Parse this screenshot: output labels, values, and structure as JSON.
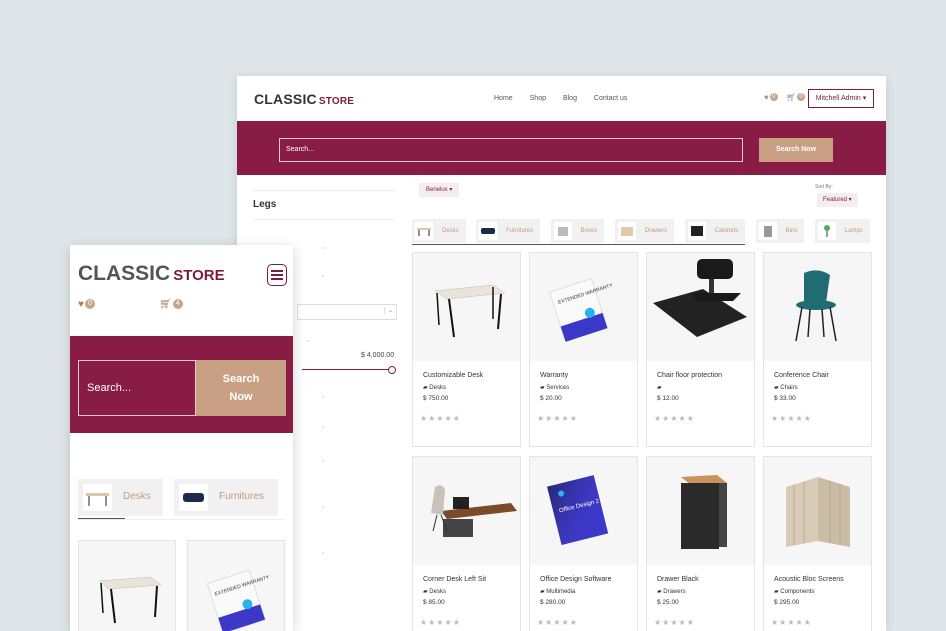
{
  "desktop": {
    "logo": {
      "main": "CLASSIC",
      "accent": "STORE"
    },
    "nav": [
      "Home",
      "Shop",
      "Blog",
      "Contact us"
    ],
    "wishlist_count": "0",
    "cart_count": "0",
    "user_label": "Mitchell Admin",
    "search": {
      "placeholder": "Search...",
      "button": "Search Now"
    },
    "sidebar": {
      "heading": "Legs",
      "range_max": "$ 4,000.00"
    },
    "region": "Benelux",
    "sort_label": "Sort By:",
    "sort_value": "Featured",
    "categories": [
      "Desks",
      "Furnitures",
      "Boxes",
      "Drawers",
      "Cabinets",
      "Bins",
      "Lamps"
    ],
    "products": [
      {
        "name": "Customizable Desk",
        "category": "Desks",
        "price": "$ 750.00"
      },
      {
        "name": "Warranty",
        "category": "Services",
        "price": "$ 20.00"
      },
      {
        "name": "Chair floor protection",
        "category": "",
        "price": "$ 12.00"
      },
      {
        "name": "Conference Chair",
        "category": "Chairs",
        "price": "$ 33.00"
      },
      {
        "name": "Corner Desk Left Sit",
        "category": "Desks",
        "price": "$ 85.00"
      },
      {
        "name": "Office Design Software",
        "category": "Multimedia",
        "price": "$ 280.00"
      },
      {
        "name": "Drawer Black",
        "category": "Drawers",
        "price": "$ 25.00"
      },
      {
        "name": "Acoustic Bloc Screens",
        "category": "Components",
        "price": "$ 295.00"
      }
    ],
    "rating_stars": "★★★★★",
    "box_text": {
      "warranty": "EXTENDED WARRANTY",
      "software": "Office Design 2"
    }
  },
  "mobile": {
    "logo": {
      "main": "CLASSIC",
      "accent": "STORE"
    },
    "wishlist_count": "0",
    "cart_count": "4",
    "search": {
      "placeholder": "Search...",
      "button": "Search Now"
    },
    "categories": [
      "Desks",
      "Furnitures"
    ]
  },
  "colors": {
    "brand": "#891c44",
    "accent": "#c9a083"
  }
}
